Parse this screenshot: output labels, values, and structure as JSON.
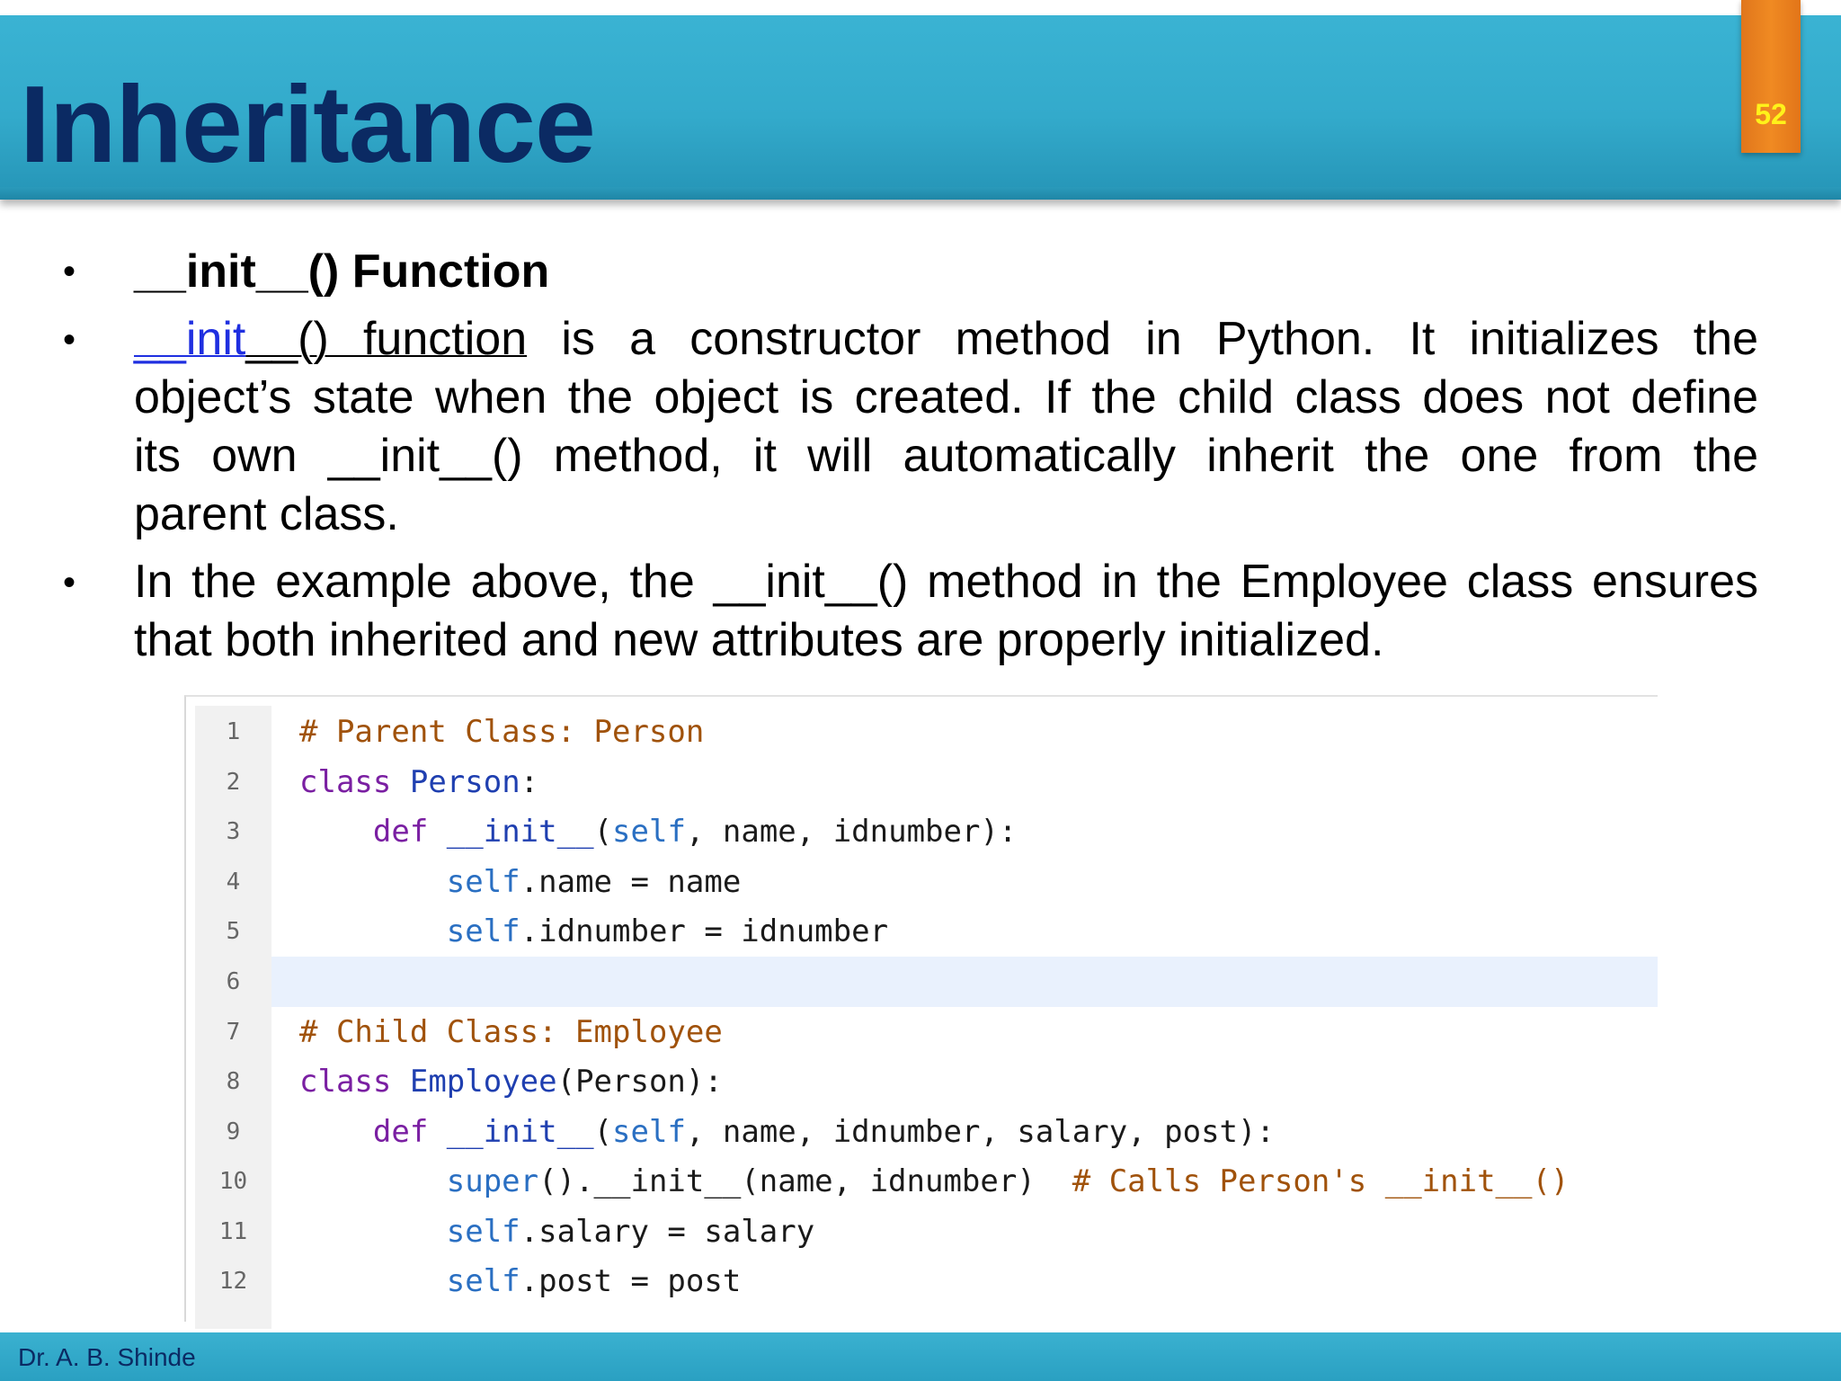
{
  "header": {
    "title": "Inheritance",
    "page_number": "52"
  },
  "bullets": {
    "item1": "__init__() Function",
    "item2": {
      "link_part1": "__init",
      "link_part2": "__() function",
      "line1_rest": " is a constructor method in Python. It initializes the",
      "line2": "object’s state when the object is created. If the child class does not define",
      "line3": "its own __init__() method, it will automatically inherit the one from the",
      "line4": "parent class."
    },
    "item3": {
      "line1": "In the example above, the __init__() method in the Employee class ensures",
      "line2": "that both inherited and new attributes are properly initialized."
    }
  },
  "code": {
    "line_numbers": [
      "1",
      "2",
      "3",
      "4",
      "5",
      "6",
      "7",
      "8",
      "9",
      "10",
      "11",
      "12"
    ],
    "l1_comment": "# Parent Class: Person",
    "l2_kw": "class",
    "l2_name": "Person",
    "l2_rest": ":",
    "l3_indent": "    ",
    "l3_kw": "def",
    "l3_fn": "__init__",
    "l3_paren": "(",
    "l3_self": "self",
    "l3_rest": ", name, idnumber):",
    "l4_indent": "        ",
    "l4_self": "self",
    "l4_rest": ".name = name",
    "l5_indent": "        ",
    "l5_self": "self",
    "l5_rest": ".idnumber = idnumber",
    "l7_comment": "# Child Class: Employee",
    "l8_kw": "class",
    "l8_name": "Employee",
    "l8_rest": "(Person):",
    "l9_indent": "    ",
    "l9_kw": "def",
    "l9_fn": "__init__",
    "l9_paren": "(",
    "l9_self": "self",
    "l9_rest": ", name, idnumber, salary, post):",
    "l10_indent": "        ",
    "l10_super": "super",
    "l10_rest": "().__init__(name, idnumber)  ",
    "l10_comment": "# Calls Person's __init__()",
    "l11_indent": "        ",
    "l11_self": "self",
    "l11_rest": ".salary = salary",
    "l12_indent": "        ",
    "l12_self": "self",
    "l12_rest": ".post = post"
  },
  "footer": {
    "author": "Dr. A. B. Shinde"
  },
  "colors": {
    "header_blue": "#33aacb",
    "title_navy": "#0b2a63",
    "badge_orange": "#f08a22",
    "badge_text_yellow": "#fff21a",
    "link_blue": "#1f2fe0",
    "code_comment": "#a0520b",
    "code_keyword": "#7a1fa2",
    "code_highlight": "#e9f1fd"
  }
}
